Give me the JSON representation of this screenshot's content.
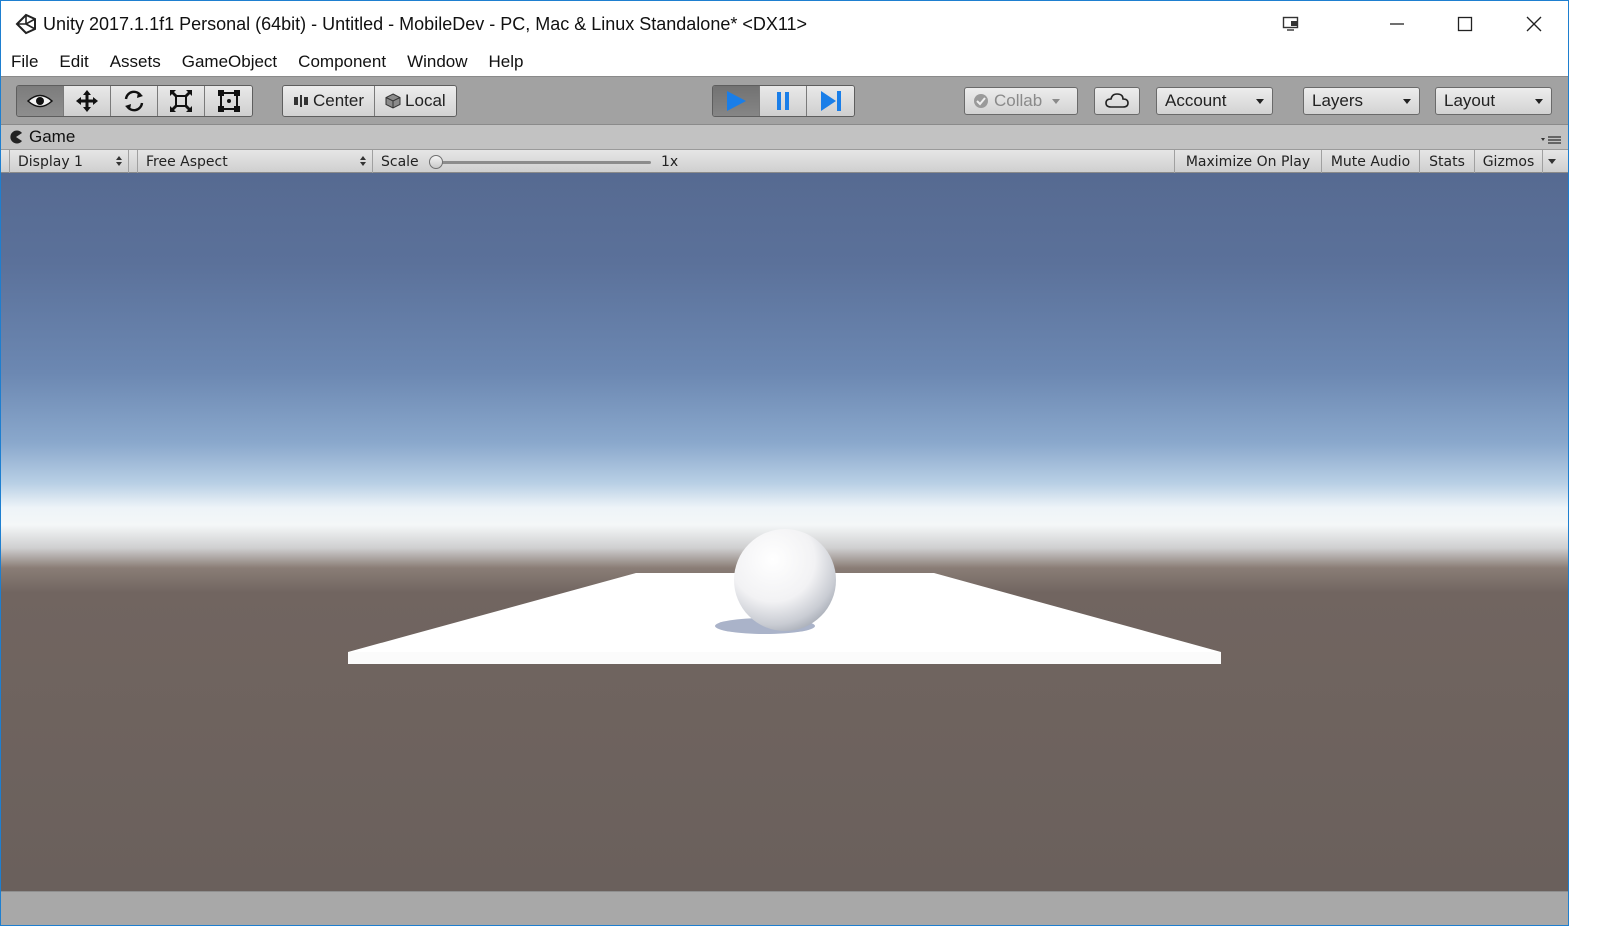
{
  "window": {
    "title": "Unity 2017.1.1f1 Personal (64bit) - Untitled - MobileDev - PC, Mac & Linux Standalone* <DX11>"
  },
  "menu": {
    "items": [
      "File",
      "Edit",
      "Assets",
      "GameObject",
      "Component",
      "Window",
      "Help"
    ]
  },
  "toolbar": {
    "transform_tools": [
      "view-tool",
      "move-tool",
      "rotate-tool",
      "scale-tool",
      "rect-tool"
    ],
    "active_tool": "view-tool",
    "pivot_mode": "Center",
    "pivot_rotation": "Local",
    "play_state": "playing",
    "collab_label": "Collab",
    "account_label": "Account",
    "layers_label": "Layers",
    "layout_label": "Layout"
  },
  "game_view": {
    "tab_label": "Game",
    "display": "Display 1",
    "aspect": "Free Aspect",
    "scale_label": "Scale",
    "scale_value": "1x",
    "scale_slider_fraction": 0.0,
    "maximize_on_play": "Maximize On Play",
    "mute_audio": "Mute Audio",
    "stats": "Stats",
    "gizmos": "Gizmos"
  },
  "colors": {
    "accent": "#1e7fd0",
    "play_blue": "#1a7ee8",
    "toolbar_bg": "#a2a2a2",
    "panel_bg": "#c2c2c2",
    "sky_top": "#566a91",
    "horizon": "#f4f7f8",
    "ground": "#6a605c"
  }
}
